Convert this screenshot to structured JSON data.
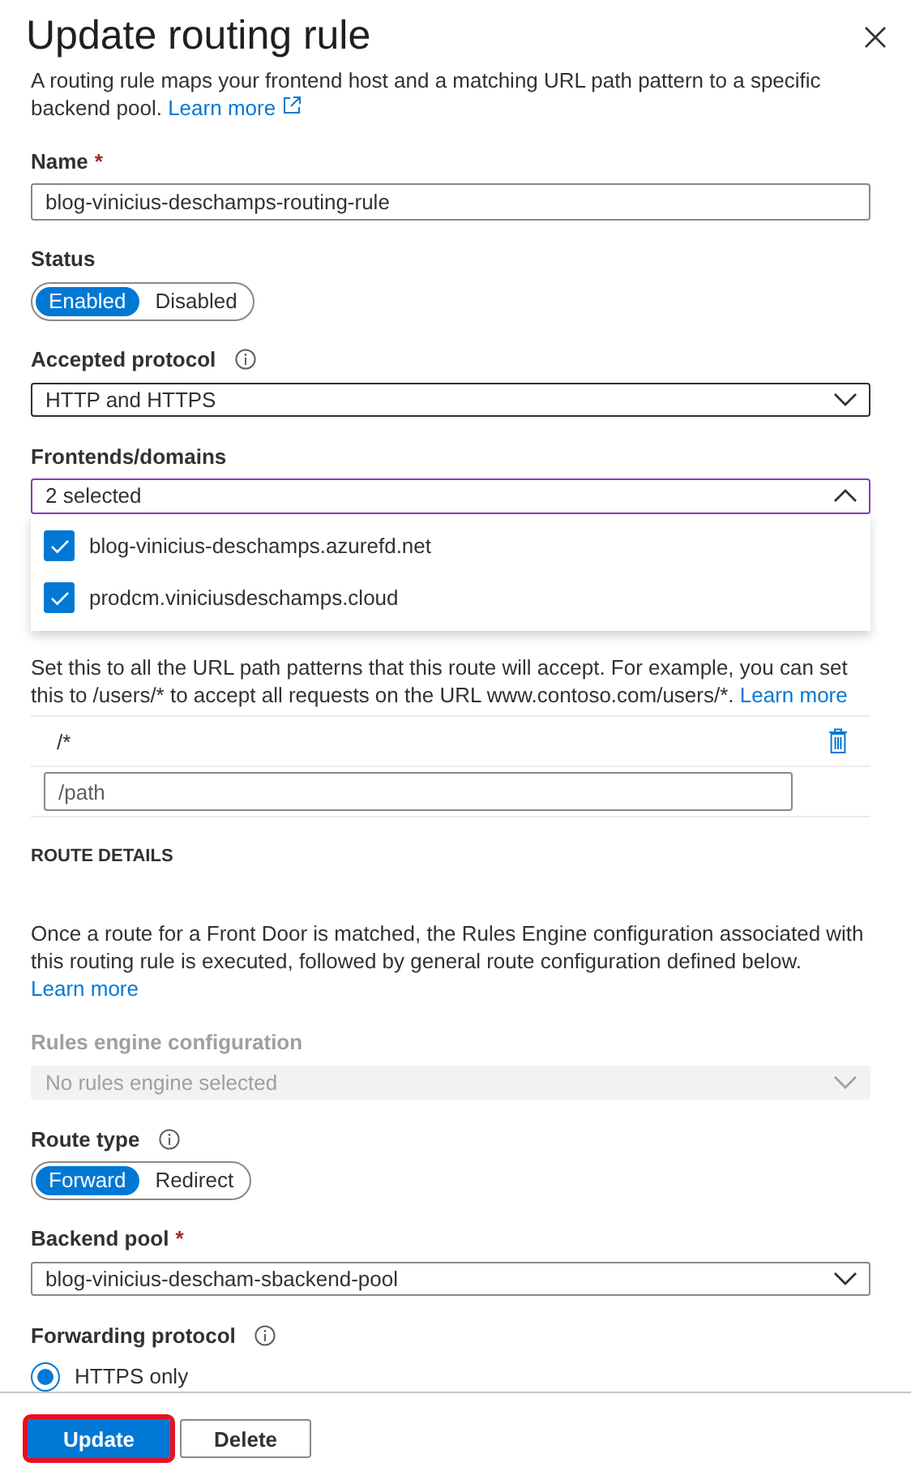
{
  "panel": {
    "title": "Update routing rule"
  },
  "intro": {
    "text": "A routing rule maps your frontend host and a matching URL path pattern to a specific backend pool.",
    "link": "Learn more"
  },
  "name": {
    "label": "Name",
    "required_mark": "*",
    "value": "blog-vinicius-deschamps-routing-rule"
  },
  "status": {
    "label": "Status",
    "options": [
      {
        "label": "Enabled",
        "selected": true
      },
      {
        "label": "Disabled",
        "selected": false
      }
    ]
  },
  "accepted_protocol": {
    "label": "Accepted protocol",
    "info": true,
    "value": "HTTP and HTTPS",
    "expanded": false
  },
  "frontends": {
    "label": "Frontends/domains",
    "value": "2 selected",
    "expanded": true,
    "options": [
      {
        "label": "blog-vinicius-deschamps.azurefd.net",
        "checked": true
      },
      {
        "label": "prodcm.viniciusdeschamps.cloud",
        "checked": true
      }
    ]
  },
  "patterns": {
    "help": "Set this to all the URL path patterns that this route will accept. For example, you can set this to /users/* to accept all requests on the URL www.contoso.com/users/*.",
    "link": "Learn more",
    "items": [
      "/*"
    ],
    "placeholder": "/path"
  },
  "route_details": {
    "heading": "ROUTE DETAILS",
    "help": "Once a route for a Front Door is matched, the Rules Engine configuration associated with this routing rule is executed, followed by general route configuration defined below.",
    "link": "Learn more"
  },
  "rules_engine": {
    "label": "Rules engine configuration",
    "value": "No rules engine selected",
    "disabled": true
  },
  "route_type": {
    "label": "Route type",
    "info": true,
    "options": [
      {
        "label": "Forward",
        "selected": true
      },
      {
        "label": "Redirect",
        "selected": false
      }
    ]
  },
  "backend_pool": {
    "label": "Backend pool",
    "required_mark": "*",
    "value": "blog-vinicius-descham-sbackend-pool",
    "expanded": false
  },
  "forwarding_protocol": {
    "label": "Forwarding protocol",
    "info": true,
    "options": [
      {
        "label": "HTTPS only",
        "selected": true
      }
    ]
  },
  "buttons": [
    {
      "label": "Update",
      "kind": "primary",
      "focused": true
    },
    {
      "label": "Delete",
      "kind": "default",
      "focused": false
    }
  ]
}
